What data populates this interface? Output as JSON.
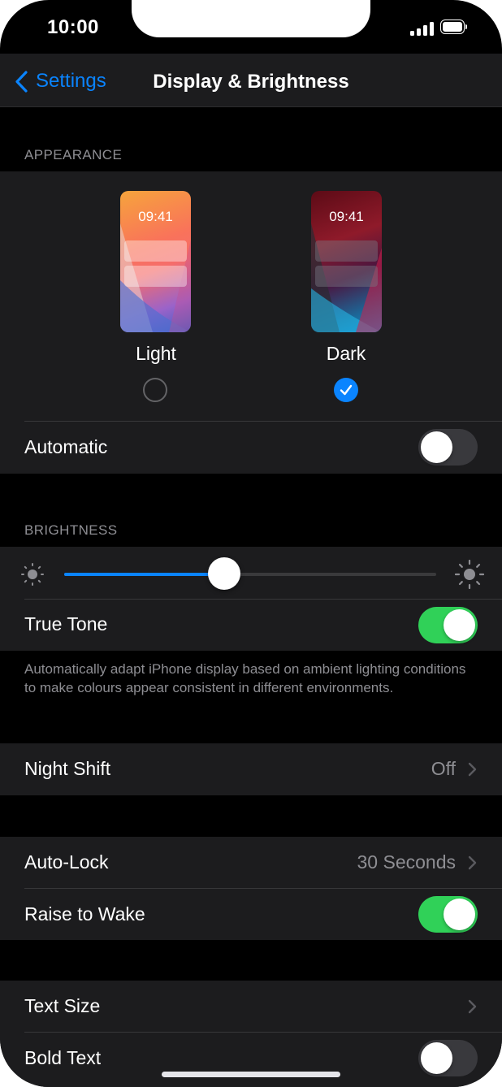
{
  "status_bar": {
    "time": "10:00"
  },
  "nav": {
    "back_label": "Settings",
    "title": "Display & Brightness"
  },
  "appearance": {
    "header": "APPEARANCE",
    "light": {
      "label": "Light",
      "preview_time": "09:41",
      "selected": false
    },
    "dark": {
      "label": "Dark",
      "preview_time": "09:41",
      "selected": true
    },
    "automatic": {
      "label": "Automatic",
      "on": false
    }
  },
  "brightness": {
    "header": "BRIGHTNESS",
    "level_fraction": 0.43,
    "true_tone": {
      "label": "True Tone",
      "on": true
    },
    "footnote": "Automatically adapt iPhone display based on ambient lighting conditions to make colours appear consistent in different environments."
  },
  "night_shift": {
    "label": "Night Shift",
    "value": "Off"
  },
  "auto_lock": {
    "label": "Auto-Lock",
    "value": "30 Seconds"
  },
  "raise_to_wake": {
    "label": "Raise to Wake",
    "on": true
  },
  "text_size": {
    "label": "Text Size"
  },
  "bold_text": {
    "label": "Bold Text",
    "on": false
  },
  "colors": {
    "accent": "#0a84ff",
    "toggle_on": "#30d158",
    "background": "#000000",
    "cell": "#1c1c1e",
    "secondary_text": "#8e8e93"
  },
  "icons": [
    "chevron-left-icon",
    "chevron-right-icon",
    "sun-small-icon",
    "sun-large-icon",
    "checkmark-icon",
    "signal-icon",
    "battery-icon"
  ]
}
